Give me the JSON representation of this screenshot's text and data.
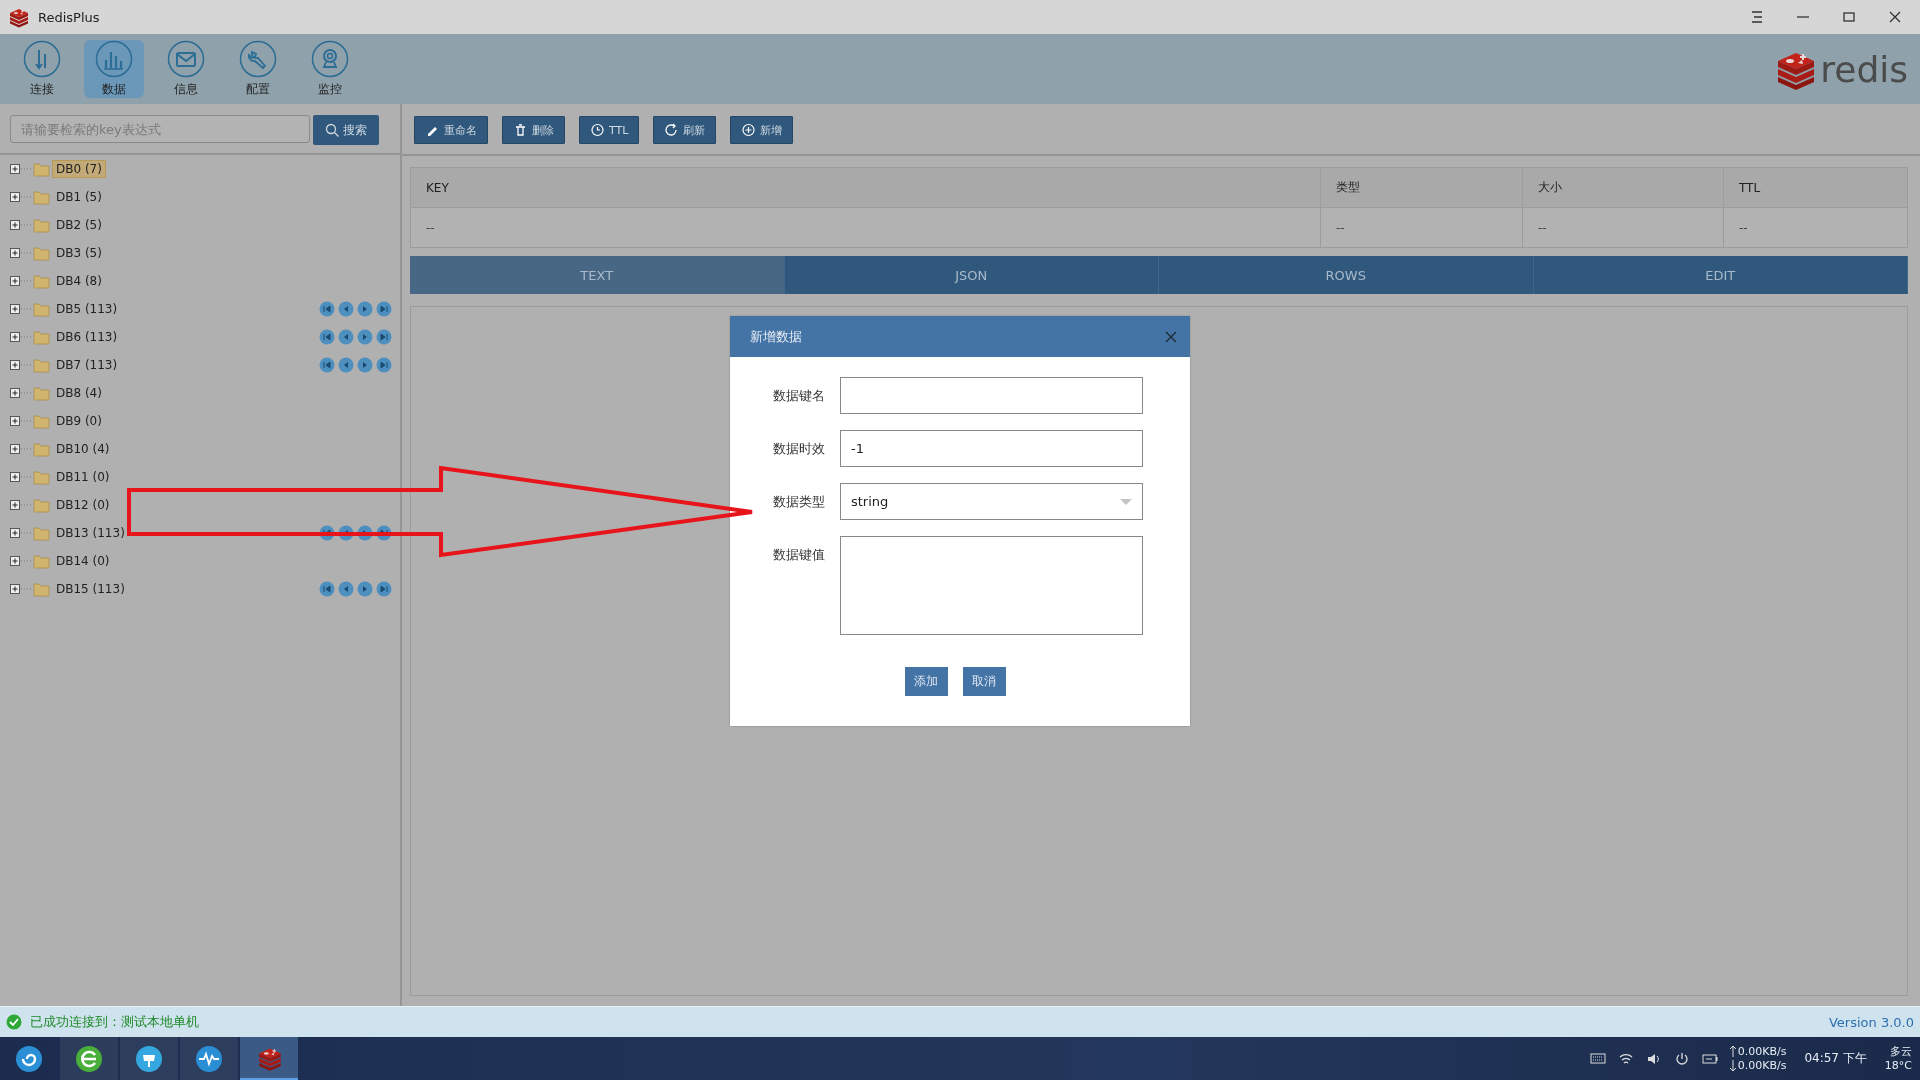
{
  "window": {
    "title": "RedisPlus"
  },
  "nav": [
    {
      "label": "连接",
      "kind": "connect",
      "selected": false
    },
    {
      "label": "数据",
      "kind": "data",
      "selected": true
    },
    {
      "label": "信息",
      "kind": "info",
      "selected": false
    },
    {
      "label": "配置",
      "kind": "config",
      "selected": false
    },
    {
      "label": "监控",
      "kind": "monitor",
      "selected": false
    }
  ],
  "brand": {
    "text": "redis"
  },
  "search": {
    "placeholder": "请输要检索的key表达式",
    "button": "搜索"
  },
  "tree": [
    {
      "label": "DB0 (7)",
      "selected": true,
      "pager": false
    },
    {
      "label": "DB1 (5)",
      "selected": false,
      "pager": false
    },
    {
      "label": "DB2 (5)",
      "selected": false,
      "pager": false
    },
    {
      "label": "DB3 (5)",
      "selected": false,
      "pager": false
    },
    {
      "label": "DB4 (8)",
      "selected": false,
      "pager": false
    },
    {
      "label": "DB5 (113)",
      "selected": false,
      "pager": true
    },
    {
      "label": "DB6 (113)",
      "selected": false,
      "pager": true
    },
    {
      "label": "DB7 (113)",
      "selected": false,
      "pager": true
    },
    {
      "label": "DB8 (4)",
      "selected": false,
      "pager": false
    },
    {
      "label": "DB9 (0)",
      "selected": false,
      "pager": false
    },
    {
      "label": "DB10 (4)",
      "selected": false,
      "pager": false
    },
    {
      "label": "DB11 (0)",
      "selected": false,
      "pager": false
    },
    {
      "label": "DB12 (0)",
      "selected": false,
      "pager": false
    },
    {
      "label": "DB13 (113)",
      "selected": false,
      "pager": true
    },
    {
      "label": "DB14 (0)",
      "selected": false,
      "pager": false
    },
    {
      "label": "DB15 (113)",
      "selected": false,
      "pager": true
    }
  ],
  "actions": [
    {
      "label": "重命名",
      "kind": "rename"
    },
    {
      "label": "删除",
      "kind": "delete"
    },
    {
      "label": "TTL",
      "kind": "ttl"
    },
    {
      "label": "刷新",
      "kind": "refresh"
    },
    {
      "label": "新增",
      "kind": "add"
    }
  ],
  "table": {
    "columns": [
      "KEY",
      "类型",
      "大小",
      "TTL"
    ],
    "rows": [
      [
        "--",
        "--",
        "--",
        "--"
      ]
    ]
  },
  "view_tabs": [
    {
      "label": "TEXT",
      "selected": true
    },
    {
      "label": "JSON",
      "selected": false
    },
    {
      "label": "ROWS",
      "selected": false
    },
    {
      "label": "EDIT",
      "selected": false
    }
  ],
  "dialog": {
    "title": "新增数据",
    "fields": [
      {
        "label": "数据键名",
        "kind": "text"
      },
      {
        "label": "数据时效",
        "kind": "text",
        "value": "-1"
      },
      {
        "label": "数据类型",
        "kind": "select",
        "value": "string"
      },
      {
        "label": "数据键值",
        "kind": "textarea"
      }
    ],
    "buttons": [
      "添加",
      "取消"
    ]
  },
  "status": {
    "message": "已成功连接到：测试本地单机",
    "version": "Version 3.0.0"
  },
  "taskbar": {
    "apps": [
      {
        "kind": "launcher",
        "selected": false
      },
      {
        "kind": "browser",
        "selected": false
      },
      {
        "kind": "store",
        "selected": false
      },
      {
        "kind": "monitor",
        "selected": false
      },
      {
        "kind": "redis",
        "selected": true
      }
    ],
    "upload": "0.00KB/s",
    "download": "0.00KB/s",
    "time": "04:57 下午",
    "weather": "多云",
    "temperature": "18°C"
  }
}
